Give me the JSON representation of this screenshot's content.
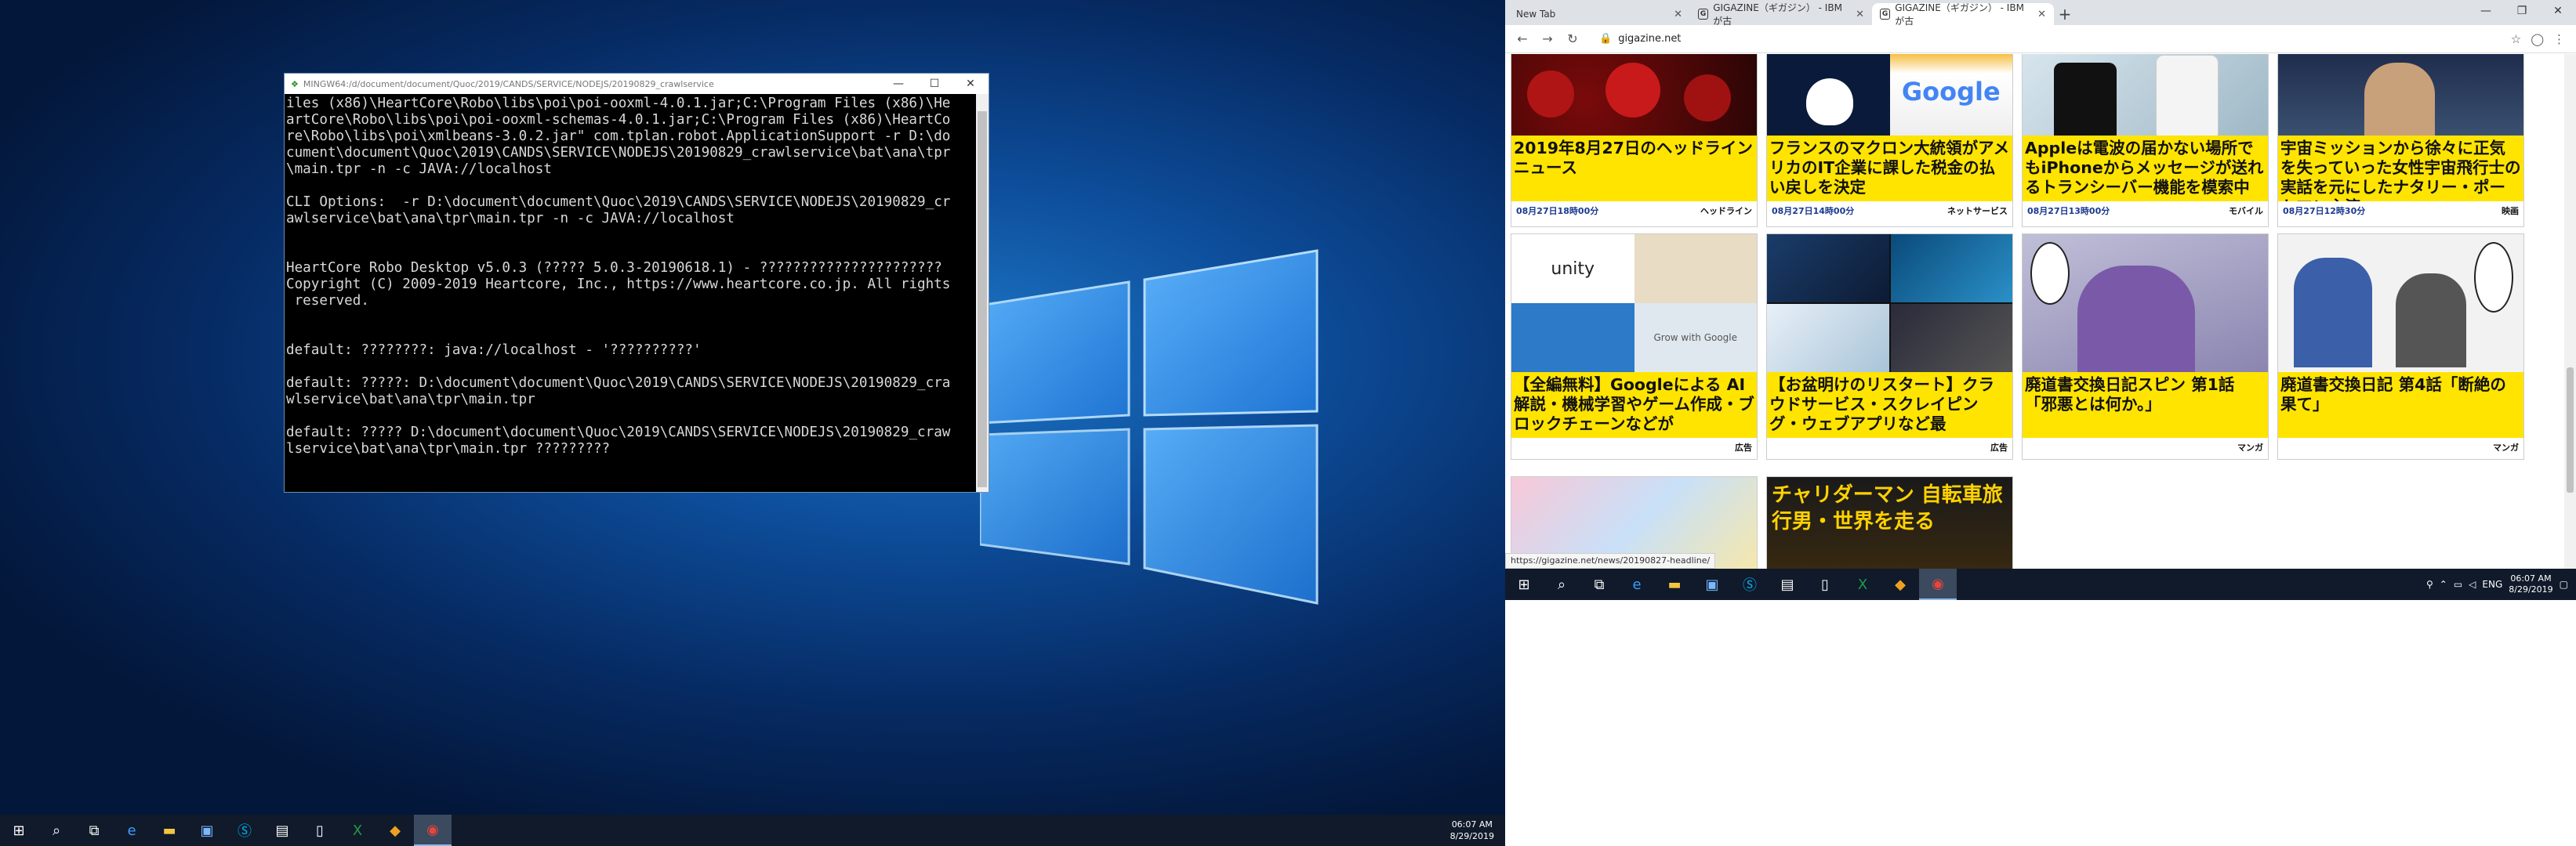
{
  "left_screen": {
    "terminal": {
      "title": "MINGW64:/d/document/document/Quoc/2019/CANDS/SERVICE/NODEJS/20190829_crawlservice",
      "lines": [
        "iles (x86)\\HeartCore\\Robo\\libs\\poi\\poi-ooxml-4.0.1.jar;C:\\Program Files (x86)\\He",
        "artCore\\Robo\\libs\\poi\\poi-ooxml-schemas-4.0.1.jar;C:\\Program Files (x86)\\HeartCo",
        "re\\Robo\\libs\\poi\\xmlbeans-3.0.2.jar\" com.tplan.robot.ApplicationSupport -r D:\\do",
        "cument\\document\\Quoc\\2019\\CANDS\\SERVICE\\NODEJS\\20190829_crawlservice\\bat\\ana\\tpr",
        "\\main.tpr -n -c JAVA://localhost",
        "",
        "CLI Options:  -r D:\\document\\document\\Quoc\\2019\\CANDS\\SERVICE\\NODEJS\\20190829_cr",
        "awlservice\\bat\\ana\\tpr\\main.tpr -n -c JAVA://localhost",
        "",
        "",
        "HeartCore Robo Desktop v5.0.3 (????? 5.0.3-20190618.1) - ??????????????????????",
        "Copyright (C) 2009-2019 Heartcore, Inc., https://www.heartcore.co.jp. All rights",
        " reserved.",
        "",
        "",
        "default: ????????: java://localhost - '??????????'",
        "",
        "default: ?????: D:\\document\\document\\Quoc\\2019\\CANDS\\SERVICE\\NODEJS\\20190829_cra",
        "wlservice\\bat\\ana\\tpr\\main.tpr",
        "",
        "default: ????? D:\\document\\document\\Quoc\\2019\\CANDS\\SERVICE\\NODEJS\\20190829_craw",
        "lservice\\bat\\ana\\tpr\\main.tpr ?????????"
      ]
    },
    "taskbar": {
      "icons": [
        "windows-start-icon",
        "search-icon",
        "task-view-icon",
        "edge-icon",
        "file-explorer-icon",
        "remote-desktop-icon",
        "skype-icon",
        "app-icon",
        "notepad-icon",
        "excel-icon",
        "git-icon",
        "chrome-icon"
      ],
      "time": "06:07 AM",
      "date": "8/29/2019"
    }
  },
  "right_screen": {
    "browser": {
      "tabs": [
        {
          "label": "New Tab",
          "favicon": ""
        },
        {
          "label": "GIGAZINE（ギガジン） - IBMが古",
          "favicon": "G"
        },
        {
          "label": "GIGAZINE（ギガジン） - IBMが古",
          "favicon": "G"
        }
      ],
      "url": "gigazine.net",
      "status_url": "https://gigazine.net/news/20190827-headline/",
      "articles_row1": [
        {
          "title": "2019年8月27日のヘッドラインニュース",
          "date": "08月27日18時00分",
          "category": "ヘッドライン"
        },
        {
          "title": "フランスのマクロン大統領がアメリカのIT企業に課した税金の払い戻しを決定",
          "date": "08月27日14時00分",
          "category": "ネットサービス"
        },
        {
          "title": "Appleは電波の届かない場所でもiPhoneからメッセージが送れるトランシーバー機能を模索中",
          "date": "08月27日13時00分",
          "category": "モバイル"
        },
        {
          "title": "宇宙ミッションから徐々に正気を失っていった女性宇宙飛行士の実話を元にしたナタリー・ポートマン主演",
          "date": "08月27日12時30分",
          "category": "映画"
        }
      ],
      "articles_row2": [
        {
          "title": "【全編無料】Googleによる AI解説・機械学習やゲーム作成・ブロックチェーンなどが",
          "date": "",
          "category": "広告"
        },
        {
          "title": "【お盆明けのリスタート】クラウドサービス・スクレイピング・ウェブアプリなど最",
          "date": "",
          "category": "広告"
        },
        {
          "title": "廃道書交換日記スピン 第1話「邪悪とは何か。」",
          "date": "",
          "category": "マンガ"
        },
        {
          "title": "廃道書交換日記 第4話「断絶の果て」",
          "date": "",
          "category": "マンガ"
        }
      ],
      "row3_banner": "チャリダーマン 自転車旅行男・世界を走る",
      "img_labels": {
        "unity": "unity",
        "google": "Google",
        "grow": "Grow with Google",
        "apple": ""
      }
    },
    "taskbar": {
      "icons": [
        "windows-start-icon",
        "search-icon",
        "task-view-icon",
        "edge-icon",
        "file-explorer-icon",
        "remote-desktop-icon",
        "skype-icon",
        "app-icon",
        "notepad-icon",
        "excel-icon",
        "git-icon",
        "chrome-icon"
      ],
      "lang": "ENG",
      "time": "06:07 AM",
      "date": "8/29/2019"
    }
  }
}
